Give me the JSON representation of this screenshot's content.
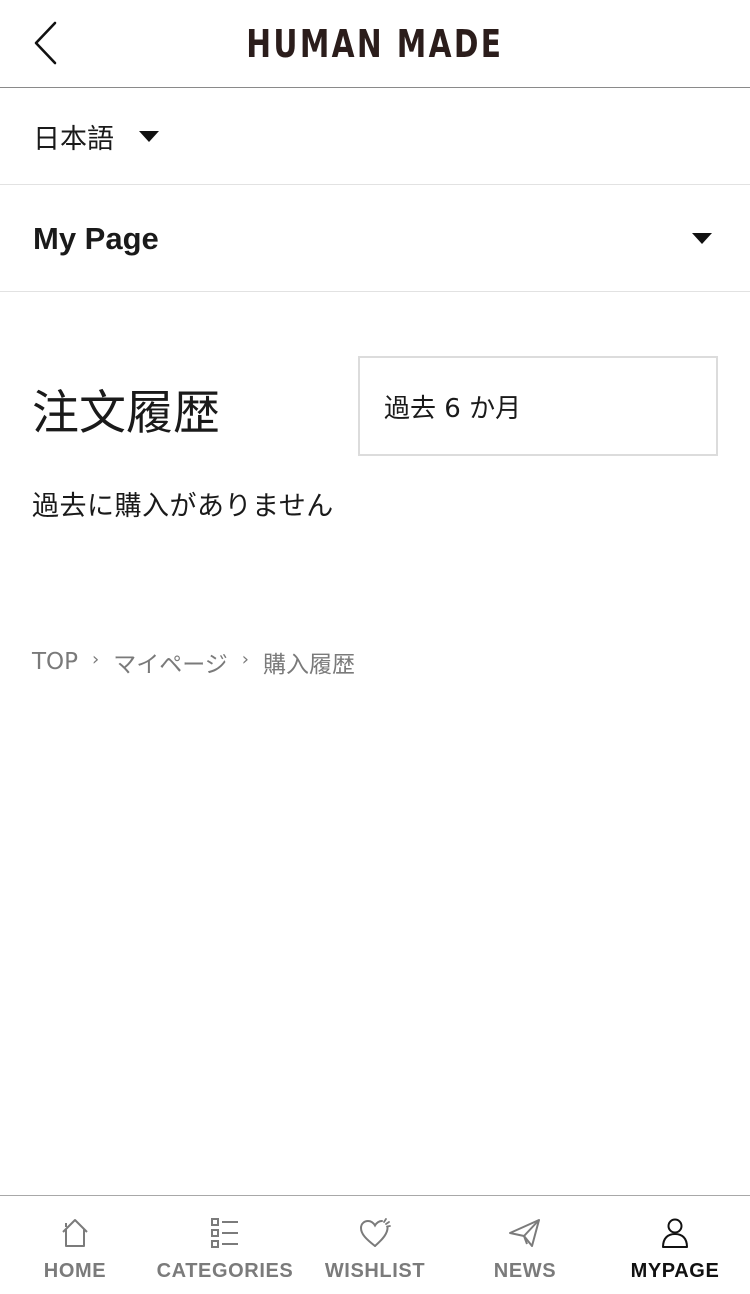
{
  "header": {
    "logo_text": "HUMAN MADE"
  },
  "language": {
    "selected": "日本語"
  },
  "section_menu": {
    "label": "My Page"
  },
  "orders": {
    "title": "注文履歴",
    "period_selected": "過去 6 か月",
    "empty_message": "過去に購入がありません"
  },
  "breadcrumb": [
    {
      "label": "TOP"
    },
    {
      "label": "マイページ"
    },
    {
      "label": "購入履歴"
    }
  ],
  "bottom_nav": [
    {
      "label": "HOME",
      "icon": "home-icon",
      "active": false
    },
    {
      "label": "CATEGORIES",
      "icon": "categories-icon",
      "active": false
    },
    {
      "label": "WISHLIST",
      "icon": "heart-icon",
      "active": false
    },
    {
      "label": "NEWS",
      "icon": "paper-plane-icon",
      "active": false
    },
    {
      "label": "MYPAGE",
      "icon": "user-icon",
      "active": true
    }
  ],
  "colors": {
    "text": "#1a1a1a",
    "muted": "#7b7b7b",
    "logo": "#2b1d1b",
    "divider": "#e2e2e2"
  }
}
